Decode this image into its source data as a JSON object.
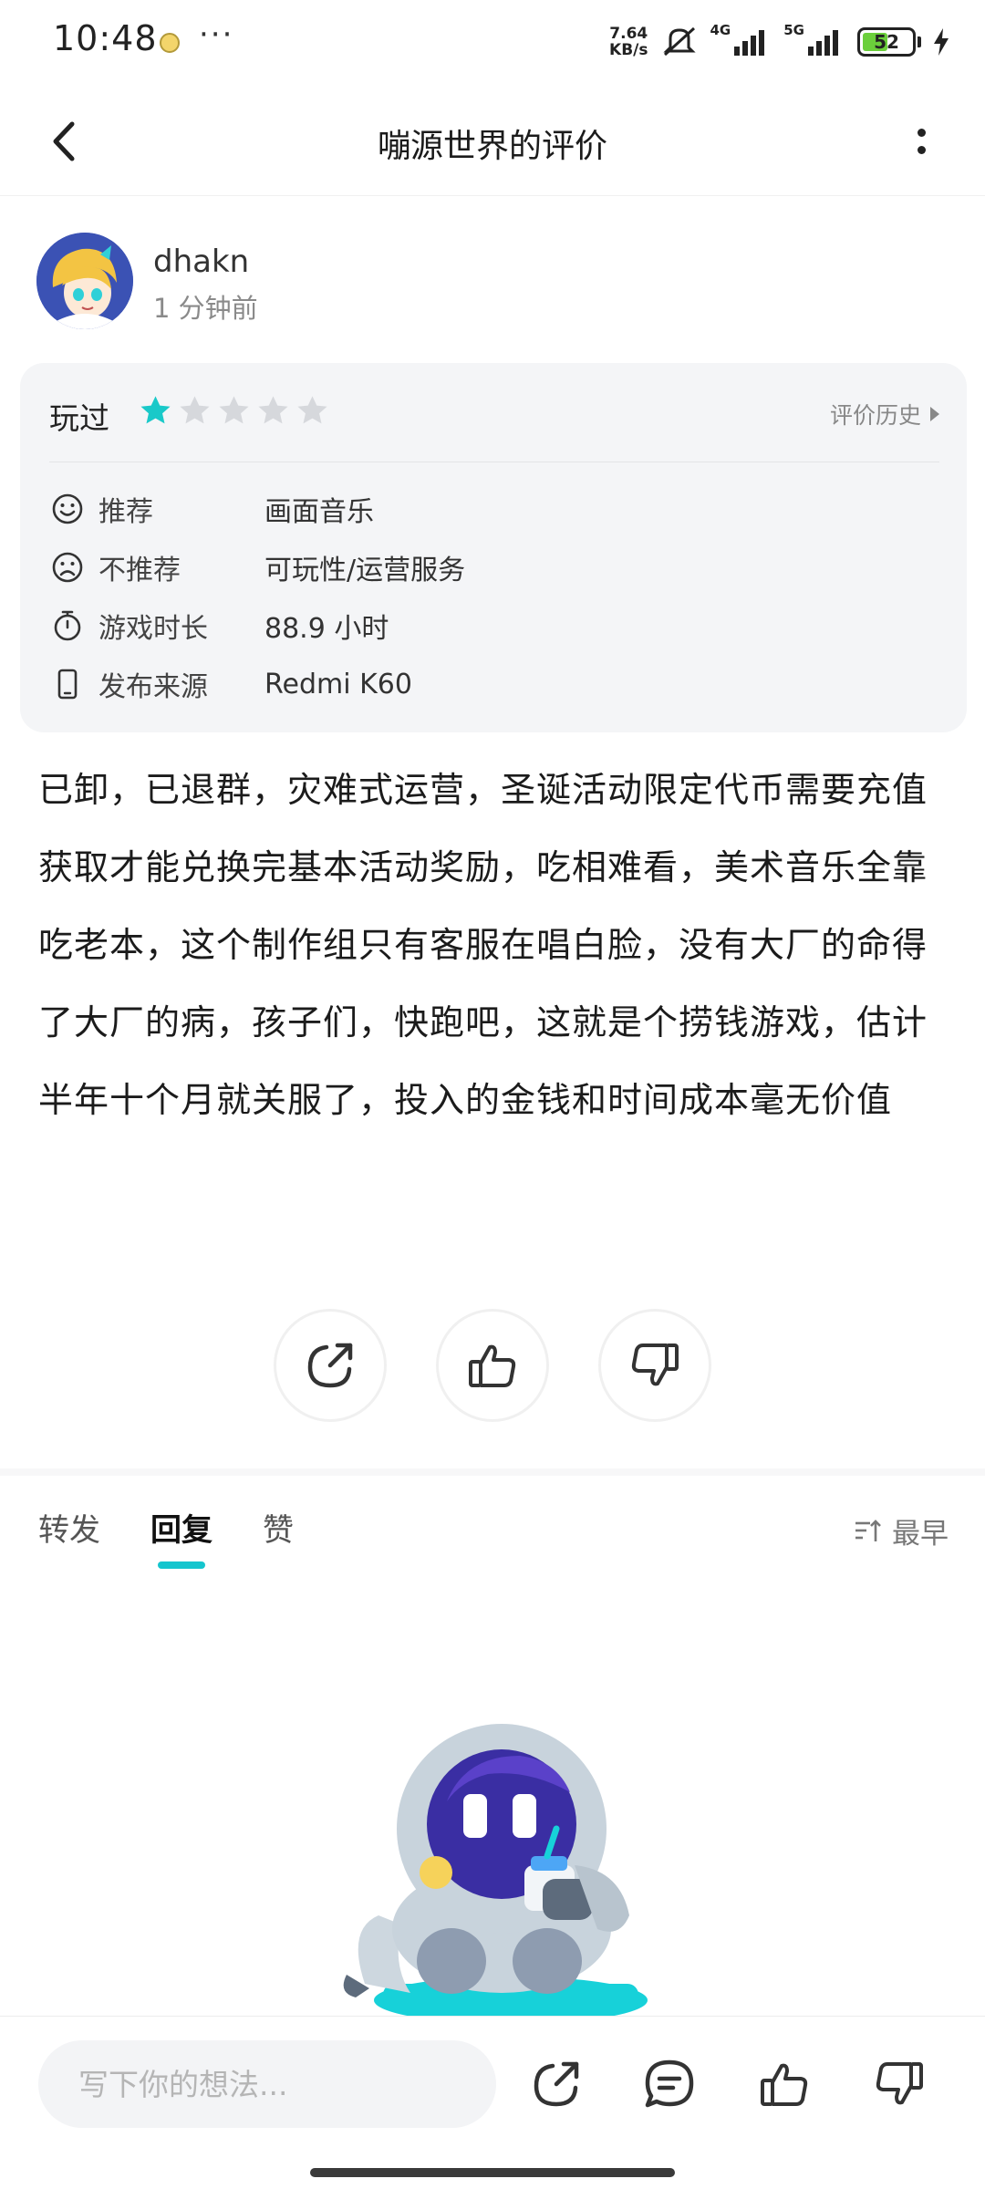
{
  "status_bar": {
    "time": "10:48",
    "dots": "···",
    "net_speed_value": "7.64",
    "net_speed_unit": "KB/s",
    "sig1_label": "4G",
    "sig2_label": "5G",
    "battery_level": "52",
    "battery_fraction": 0.52,
    "battery_color": "#6bcf3b"
  },
  "header": {
    "title": "嘣源世界的评价"
  },
  "author": {
    "name": "dhakn",
    "time": "1 分钟前"
  },
  "review_card": {
    "played_label": "玩过",
    "rating": 1,
    "rating_max": 5,
    "star_color": "#19c9c9",
    "history_label": "评价历史",
    "rows": [
      {
        "icon": "smile-icon",
        "label": "推荐",
        "value": "画面音乐"
      },
      {
        "icon": "frown-icon",
        "label": "不推荐",
        "value": "可玩性/运营服务"
      },
      {
        "icon": "stopwatch-icon",
        "label": "游戏时长",
        "value": "88.9 小时"
      },
      {
        "icon": "phone-icon",
        "label": "发布来源",
        "value": "Redmi K60"
      }
    ]
  },
  "review_text": "已卸，已退群，灾难式运营，圣诞活动限定代币需要充值获取才能兑换完基本活动奖励，吃相难看，美术音乐全靠吃老本，这个制作组只有客服在唱白脸，没有大厂的命得了大厂的病，孩子们，快跑吧，这就是个捞钱游戏，估计半年十个月就关服了，投入的金钱和时间成本毫无价值",
  "actions": {
    "share_icon": "share-icon",
    "like_icon": "thumbs-up-icon",
    "dislike_icon": "thumbs-down-icon"
  },
  "tabs": [
    {
      "label": "转发",
      "active": false
    },
    {
      "label": "回复",
      "active": true
    },
    {
      "label": "赞",
      "active": false
    }
  ],
  "accent_color": "#15c5ce",
  "sort": {
    "label": "最早",
    "icon": "sort-icon"
  },
  "bottom_bar": {
    "input_placeholder": "写下你的想法..."
  }
}
